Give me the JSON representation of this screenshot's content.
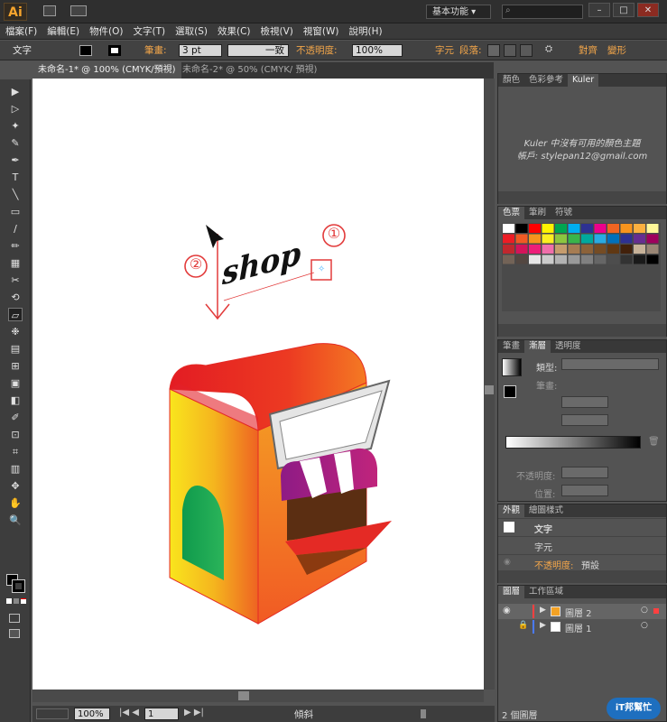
{
  "app": {
    "logo": "Ai",
    "workspace": "基本功能"
  },
  "window_buttons": [
    "–",
    "□",
    "✕"
  ],
  "menu": [
    "檔案(F)",
    "編輯(E)",
    "物件(O)",
    "文字(T)",
    "選取(S)",
    "效果(C)",
    "檢視(V)",
    "視窗(W)",
    "說明(H)"
  ],
  "control_bar": {
    "context": "文字",
    "stroke_label": "筆畫:",
    "stroke_value": "3 pt",
    "stroke_profile": "一致",
    "opacity_label": "不透明度:",
    "opacity_value": "100%",
    "char_label": "字元",
    "para_label": "段落:",
    "align_label": "對齊",
    "transform_label": "變形"
  },
  "tabs": [
    "未命名-1* @ 100% (CMYK/預視)",
    "未命名-2* @ 50% (CMYK/ 預視)"
  ],
  "tools": [
    "▶",
    "▷",
    "✦",
    "✎",
    "✒",
    "T",
    "╲",
    "▭",
    "∕",
    "✏",
    "▦",
    "✂",
    "⟲",
    "▱",
    "❉",
    "▤",
    "⊞",
    "▣",
    "◧",
    "✐",
    "⊡",
    "⌗",
    "▥",
    "✥",
    "✋",
    "🔍"
  ],
  "canvas": {
    "annotation_1": "①",
    "annotation_2": "②",
    "shop_text": "shop"
  },
  "colors": {
    "accent": "#f3a64a",
    "annotation_red": "#e23b3b",
    "selection_cyan": "#4fb8ff",
    "house_red": "#e42a25",
    "house_yellow": "#f8d51f",
    "door_green": "#1b9b48",
    "awning_purple": "#b01d8a"
  },
  "kuler": {
    "tabs": [
      "顏色",
      "色彩參考",
      "Kuler"
    ],
    "message": "Kuler 中沒有可用的顏色主題",
    "account": "帳戶: stylepan12@gmail.com"
  },
  "swatches": {
    "tabs": [
      "色票",
      "筆刷",
      "符號"
    ]
  },
  "gradient": {
    "tabs": [
      "筆畫",
      "漸層",
      "透明度"
    ],
    "type_label": "類型:",
    "stroke_label": "筆畫:",
    "opacity_label": "不透明度:",
    "location_label": "位置:"
  },
  "appearance": {
    "tabs": [
      "外觀",
      "繪圖樣式"
    ],
    "rows": [
      {
        "label": "文字"
      },
      {
        "label": "字元"
      },
      {
        "label": "不透明度:",
        "value": "預設"
      }
    ]
  },
  "layers": {
    "tabs": [
      "圖層",
      "工作區域"
    ],
    "items": [
      {
        "name": "圖層 2",
        "color": "#ff4040"
      },
      {
        "name": "圖層 1",
        "color": "#4a7aff"
      }
    ],
    "footer": "2 個圖層"
  },
  "status": {
    "zoom": "100%",
    "page": "1",
    "tool_name": "傾斜"
  },
  "watermark": {
    "logo": "iT邦幫忙"
  }
}
